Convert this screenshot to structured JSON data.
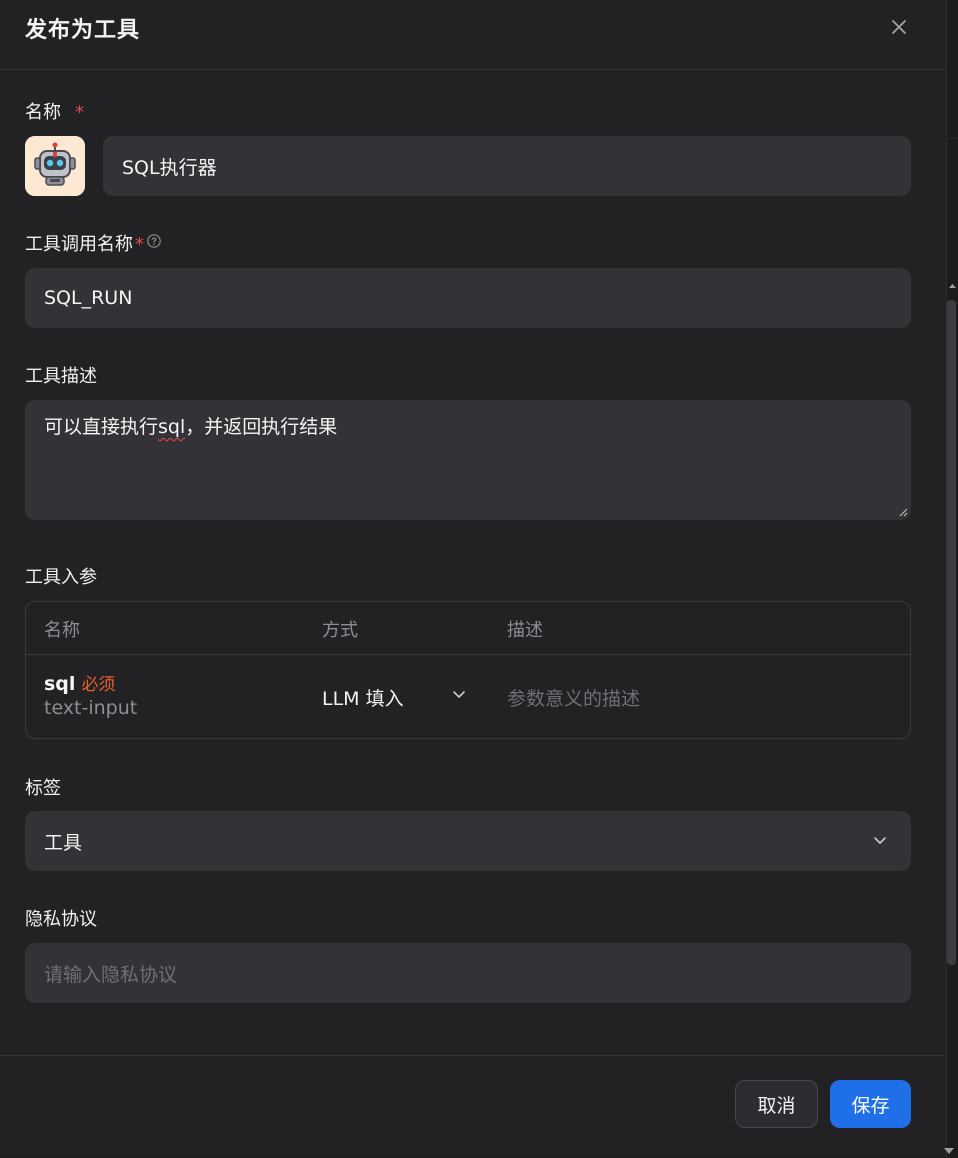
{
  "dialog": {
    "title": "发布为工具"
  },
  "name_field": {
    "label": "名称",
    "required_mark": "*",
    "value": "SQL执行器"
  },
  "call_name_field": {
    "label": "工具调用名称",
    "required_mark": "*",
    "value": "SQL_RUN"
  },
  "description_field": {
    "label": "工具描述",
    "value_before": "可以直接执行",
    "value_misspelled": "sql",
    "value_after": "，并返回执行结果"
  },
  "params_section": {
    "label": "工具入参",
    "columns": [
      "名称",
      "方式",
      "描述"
    ],
    "rows": [
      {
        "name": "sql",
        "required_tag": "必须",
        "type": "text-input",
        "method": "LLM 填入",
        "description_placeholder": "参数意义的描述"
      }
    ]
  },
  "tags_field": {
    "label": "标签",
    "selected": "工具"
  },
  "privacy_field": {
    "label": "隐私协议",
    "placeholder": "请输入隐私协议"
  },
  "footer": {
    "cancel_label": "取消",
    "save_label": "保存"
  },
  "colors": {
    "background": "#222225",
    "input_bg": "#333337",
    "required": "#e5484d",
    "required_tag": "#e8612c",
    "primary": "#1f6fe8"
  },
  "icons": {
    "close": "close-icon",
    "avatar": "robot-avatar-icon",
    "help": "question-circle-icon",
    "chevron": "chevron-down-icon"
  }
}
